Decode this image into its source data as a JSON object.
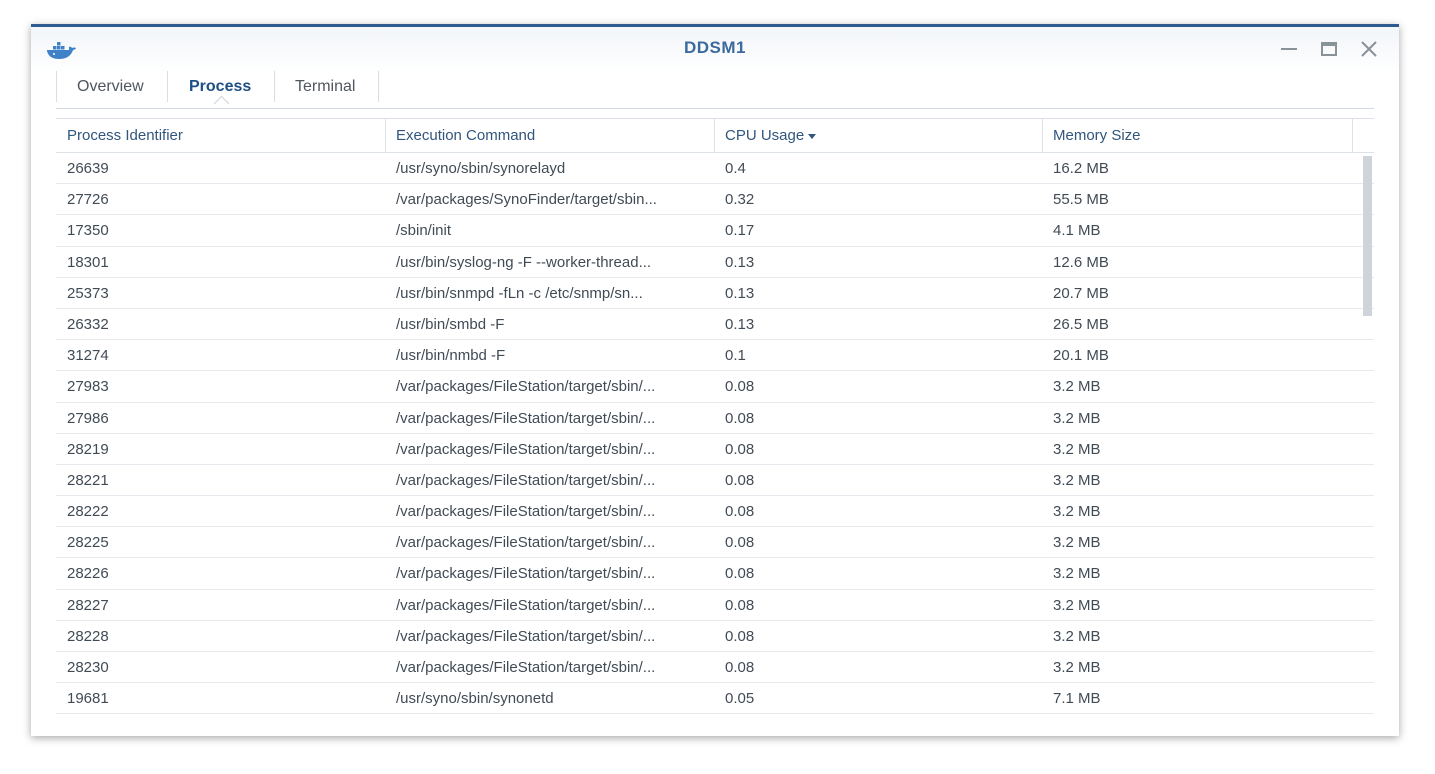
{
  "window": {
    "title": "DDSM1",
    "icon": "docker-whale-icon",
    "controls": [
      "minimize-icon",
      "maximize-icon",
      "close-icon"
    ]
  },
  "tabs": [
    {
      "label": "Overview",
      "active": false
    },
    {
      "label": "Process",
      "active": true
    },
    {
      "label": "Terminal",
      "active": false
    }
  ],
  "table": {
    "columns": [
      "Process Identifier",
      "Execution Command",
      "CPU Usage",
      "Memory Size"
    ],
    "sort": {
      "column": "CPU Usage",
      "direction": "descending"
    },
    "rows": [
      {
        "pid": "26639",
        "command": "/usr/syno/sbin/synorelayd",
        "cpu": "0.4",
        "memory": "16.2 MB"
      },
      {
        "pid": "27726",
        "command": "/var/packages/SynoFinder/target/sbin...",
        "cpu": "0.32",
        "memory": "55.5 MB"
      },
      {
        "pid": "17350",
        "command": "/sbin/init",
        "cpu": "0.17",
        "memory": "4.1 MB"
      },
      {
        "pid": "18301",
        "command": "/usr/bin/syslog-ng -F --worker-thread...",
        "cpu": "0.13",
        "memory": "12.6 MB"
      },
      {
        "pid": "25373",
        "command": "/usr/bin/snmpd -fLn -c /etc/snmp/sn...",
        "cpu": "0.13",
        "memory": "20.7 MB"
      },
      {
        "pid": "26332",
        "command": "/usr/bin/smbd -F",
        "cpu": "0.13",
        "memory": "26.5 MB"
      },
      {
        "pid": "31274",
        "command": "/usr/bin/nmbd -F",
        "cpu": "0.1",
        "memory": "20.1 MB"
      },
      {
        "pid": "27983",
        "command": "/var/packages/FileStation/target/sbin/...",
        "cpu": "0.08",
        "memory": "3.2 MB"
      },
      {
        "pid": "27986",
        "command": "/var/packages/FileStation/target/sbin/...",
        "cpu": "0.08",
        "memory": "3.2 MB"
      },
      {
        "pid": "28219",
        "command": "/var/packages/FileStation/target/sbin/...",
        "cpu": "0.08",
        "memory": "3.2 MB"
      },
      {
        "pid": "28221",
        "command": "/var/packages/FileStation/target/sbin/...",
        "cpu": "0.08",
        "memory": "3.2 MB"
      },
      {
        "pid": "28222",
        "command": "/var/packages/FileStation/target/sbin/...",
        "cpu": "0.08",
        "memory": "3.2 MB"
      },
      {
        "pid": "28225",
        "command": "/var/packages/FileStation/target/sbin/...",
        "cpu": "0.08",
        "memory": "3.2 MB"
      },
      {
        "pid": "28226",
        "command": "/var/packages/FileStation/target/sbin/...",
        "cpu": "0.08",
        "memory": "3.2 MB"
      },
      {
        "pid": "28227",
        "command": "/var/packages/FileStation/target/sbin/...",
        "cpu": "0.08",
        "memory": "3.2 MB"
      },
      {
        "pid": "28228",
        "command": "/var/packages/FileStation/target/sbin/...",
        "cpu": "0.08",
        "memory": "3.2 MB"
      },
      {
        "pid": "28230",
        "command": "/var/packages/FileStation/target/sbin/...",
        "cpu": "0.08",
        "memory": "3.2 MB"
      },
      {
        "pid": "19681",
        "command": "/usr/syno/sbin/synonetd",
        "cpu": "0.05",
        "memory": "7.1 MB"
      }
    ]
  },
  "colors": {
    "accent": "#2e5a8f",
    "title_text": "#3b6a9e",
    "header_text": "#31557c",
    "cell_text": "#414b55"
  }
}
